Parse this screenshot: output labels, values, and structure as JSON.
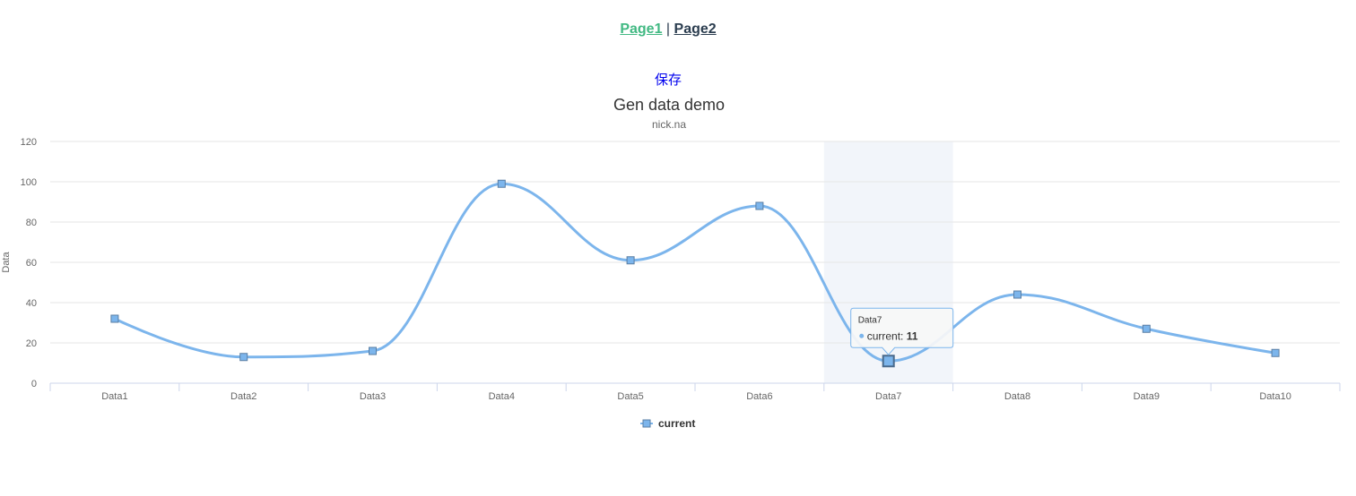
{
  "nav": {
    "page1_label": "Page1",
    "separator": "|",
    "page2_label": "Page2"
  },
  "toolbar": {
    "save_label": "保存"
  },
  "colors": {
    "series": "#7cb5ec",
    "marker_stroke": "#5a7ea3",
    "grid": "#e6e6e6",
    "axis": "#ccd6eb",
    "highlight_band": "#ccd6eb",
    "link_active": "#42b983",
    "link": "#2c3e50",
    "save": "#0000ee"
  },
  "chart_data": {
    "type": "line",
    "smooth": true,
    "title": "Gen data demo",
    "subtitle": "nick.na",
    "ylabel": "Data",
    "xlabel": "",
    "ylim": [
      0,
      120
    ],
    "yticks": [
      0,
      20,
      40,
      60,
      80,
      100,
      120
    ],
    "grid": true,
    "legend_position": "bottom-center",
    "categories": [
      "Data1",
      "Data2",
      "Data3",
      "Data4",
      "Data5",
      "Data6",
      "Data7",
      "Data8",
      "Data9",
      "Data10"
    ],
    "series": [
      {
        "name": "current",
        "marker": "square",
        "values": [
          32,
          13,
          16,
          99,
          61,
          88,
          11,
          44,
          27,
          15
        ]
      }
    ],
    "tooltip": {
      "category": "Data7",
      "series": "current",
      "separator": ": ",
      "value": "11",
      "index": 6
    }
  }
}
